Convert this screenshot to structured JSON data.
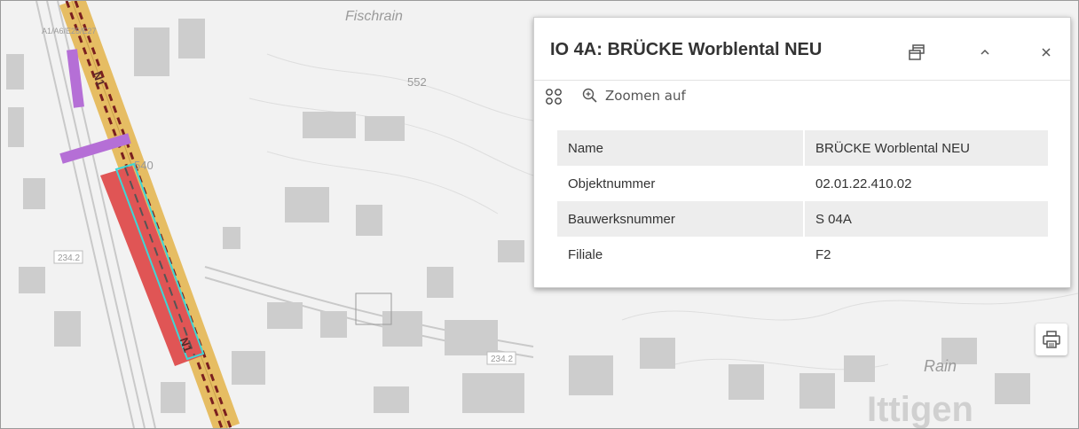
{
  "map": {
    "labels": {
      "fischrain": "Fischrain",
      "road_code": "A1/A6/E25/E27",
      "elev_552": "552",
      "elev_540": "540",
      "road_234_west": "234.2",
      "road_234_center": "234.2",
      "road_n1_top": "N1",
      "road_n1_bottom": "N1",
      "rain": "Rain",
      "ittigen": "Ittigen"
    },
    "colors": {
      "background": "#f3f3f3",
      "highway": "#e8b84a",
      "highway_dash": "#7a1f1f",
      "selected_fill": "#e05555",
      "selected_outline": "#3fd6d6",
      "purple_feature": "#b56fd6"
    }
  },
  "popup": {
    "title": "IO 4A: BRÜCKE Worblental NEU",
    "header_icons": [
      "dock-icon",
      "collapse-icon",
      "close-icon"
    ],
    "toolbar": {
      "zoom_label": "Zoomen auf"
    },
    "attributes": [
      {
        "key": "Name",
        "value": "BRÜCKE Worblental NEU"
      },
      {
        "key": "Objektnummer",
        "value": "02.01.22.410.02"
      },
      {
        "key": "Bauwerksnummer",
        "value": "S 04A"
      },
      {
        "key": "Filiale",
        "value": "F2"
      }
    ]
  },
  "print_button": {
    "icon": "print-icon"
  }
}
